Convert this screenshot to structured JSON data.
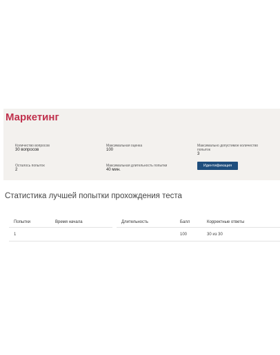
{
  "test": {
    "title": "Маркетинг",
    "fields": [
      {
        "label": "Количество вопросов",
        "value": "30 вопросов"
      },
      {
        "label": "Максимальная оценка",
        "value": "100"
      },
      {
        "label": "Максимально допустимое количество попыток",
        "value": "3"
      },
      {
        "label": "Осталось попыток",
        "value": "2"
      },
      {
        "label": "Максимальная длительность попытки",
        "value": "40 мин."
      }
    ],
    "identify_button": "Идентификация"
  },
  "stats": {
    "heading": "Статистика лучшей попытки прохождения теста",
    "columns": [
      "Попытки",
      "Время начала",
      "Длительность",
      "Балл",
      "Корректные ответы"
    ],
    "rows": [
      [
        "1",
        "",
        "",
        "100",
        "30 из 30"
      ]
    ]
  },
  "colors": {
    "title": "#c0304c",
    "button": "#1f4e7d",
    "card_background": "#f3f1ee"
  }
}
